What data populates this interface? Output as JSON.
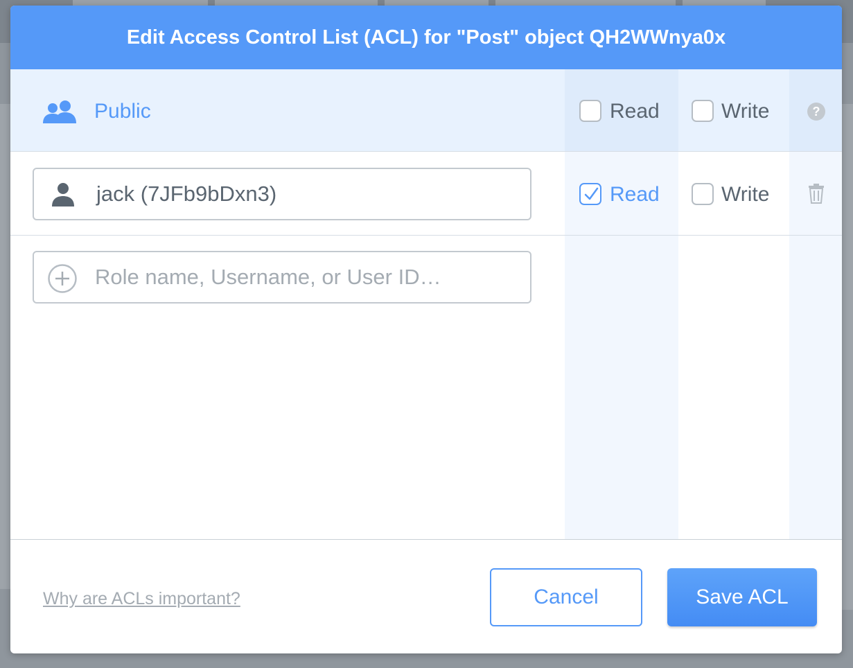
{
  "modal": {
    "title": "Edit Access Control List (ACL) for \"Post\" object QH2WWnya0x"
  },
  "public_row": {
    "label": "Public",
    "read": {
      "label": "Read",
      "checked": false
    },
    "write": {
      "label": "Write",
      "checked": false
    },
    "help_glyph": "?"
  },
  "user_row": {
    "name": "jack (7JFb9bDxn3)",
    "read": {
      "label": "Read",
      "checked": true
    },
    "write": {
      "label": "Write",
      "checked": false
    }
  },
  "add_entry": {
    "placeholder": "Role name, Username, or User ID…"
  },
  "footer": {
    "why_link": "Why are ACLs important?",
    "cancel_label": "Cancel",
    "save_label": "Save ACL"
  },
  "colors": {
    "accent": "#5599f8",
    "header_bg": "#5599f8",
    "row_highlight": "#e8f2fe",
    "text_muted": "#5a6570"
  },
  "icons": {
    "public": "group-icon",
    "user": "user-icon",
    "add": "plus-circle-icon",
    "help": "help-icon",
    "delete": "trash-icon"
  }
}
